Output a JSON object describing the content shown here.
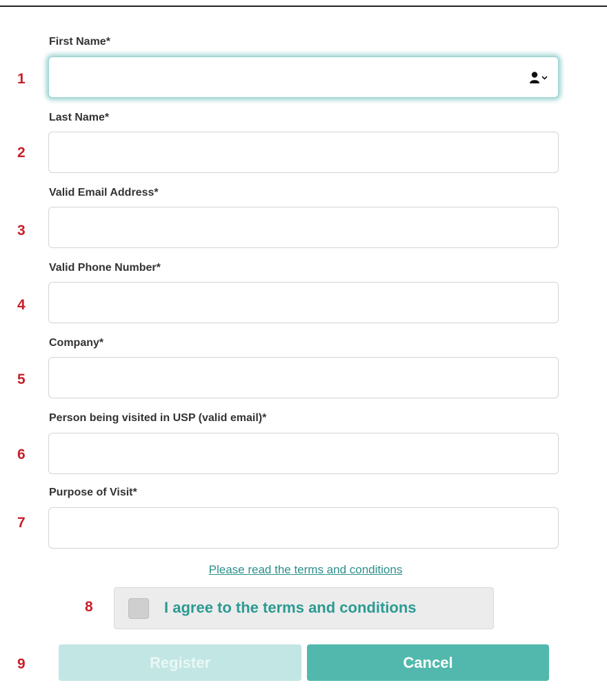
{
  "form": {
    "fields": [
      {
        "label": "First Name*",
        "value": "",
        "placeholder": "",
        "step": "1"
      },
      {
        "label": "Last Name*",
        "value": "",
        "placeholder": "",
        "step": "2"
      },
      {
        "label": "Valid Email Address*",
        "value": "",
        "placeholder": "",
        "step": "3"
      },
      {
        "label": "Valid Phone Number*",
        "value": "",
        "placeholder": "",
        "step": "4"
      },
      {
        "label": "Company*",
        "value": "",
        "placeholder": "",
        "step": "5"
      },
      {
        "label": "Person being visited in USP (valid email)*",
        "value": "",
        "placeholder": "",
        "step": "6"
      },
      {
        "label": "Purpose of Visit*",
        "value": "",
        "placeholder": "",
        "step": "7"
      }
    ],
    "first_name_icon": "person-dropdown-icon",
    "terms_link": "Please read the terms and conditions",
    "agree": {
      "step": "8",
      "label": "I agree to the terms and conditions",
      "checked": false
    },
    "buttons": {
      "step": "9",
      "register": "Register",
      "cancel": "Cancel"
    }
  },
  "colors": {
    "step_number": "#c8202a",
    "accent": "#52b8ad",
    "accent_disabled": "#c2e6e3",
    "link": "#2a8f8a",
    "focus_glow": "#74c4be"
  }
}
